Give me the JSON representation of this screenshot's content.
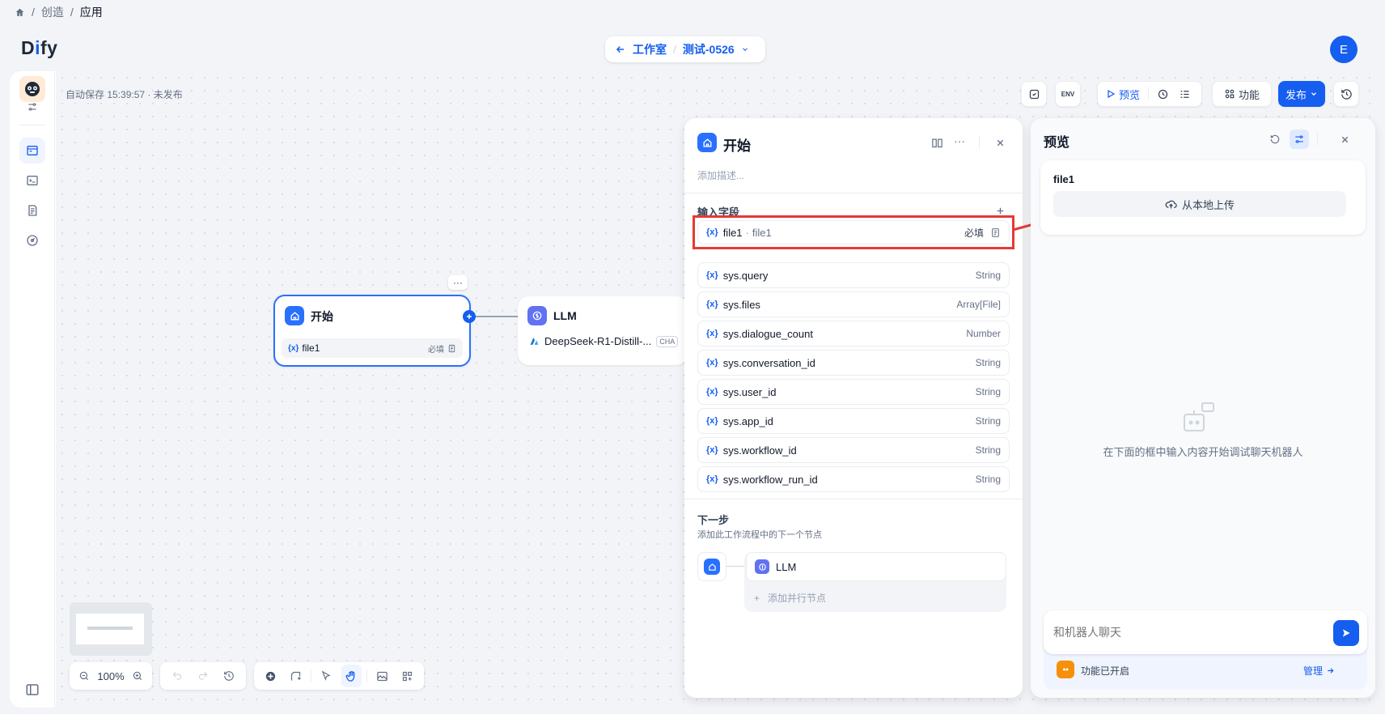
{
  "breadcrumb": {
    "items": [
      "创造",
      "应用"
    ]
  },
  "logo": {
    "d": "D",
    "i": "i",
    "fy": "fy"
  },
  "header": {
    "back_label": "工作室",
    "app_name": "测试-0526",
    "avatar_initial": "E"
  },
  "canvas": {
    "autosave": "自动保存 15:39:57 · 未发布",
    "toolbar": {
      "env_label": "ENV",
      "preview_label": "预览",
      "features_label": "功能",
      "publish_label": "发布"
    },
    "start_node": {
      "title": "开始",
      "field": "file1",
      "required": "必填"
    },
    "llm_node": {
      "title": "LLM",
      "model": "DeepSeek-R1-Distill-...",
      "badge": "CHA"
    },
    "zoom": "100%"
  },
  "start_panel": {
    "title": "开始",
    "description_placeholder": "添加描述...",
    "inputs_label": "输入字段",
    "input_field": {
      "name": "file1",
      "label": "file1",
      "required": "必填"
    },
    "sys_vars": [
      {
        "name": "sys.query",
        "type": "String"
      },
      {
        "name": "sys.files",
        "type": "Array[File]"
      },
      {
        "name": "sys.dialogue_count",
        "type": "Number"
      },
      {
        "name": "sys.conversation_id",
        "type": "String"
      },
      {
        "name": "sys.user_id",
        "type": "String"
      },
      {
        "name": "sys.app_id",
        "type": "String"
      },
      {
        "name": "sys.workflow_id",
        "type": "String"
      },
      {
        "name": "sys.workflow_run_id",
        "type": "String"
      }
    ],
    "var_prefix": "{x}",
    "next_step": {
      "title": "下一步",
      "description": "添加此工作流程中的下一个节点",
      "node": "LLM",
      "add_parallel": "添加并行节点"
    }
  },
  "preview_panel": {
    "title": "预览",
    "file_label": "file1",
    "upload_label": "从本地上传",
    "empty_hint": "在下面的框中输入内容开始调试聊天机器人",
    "chat_placeholder": "和机器人聊天",
    "features_enabled": "功能已开启",
    "manage_label": "管理"
  },
  "colors": {
    "accent": "#155eef",
    "highlight": "#e53935"
  }
}
